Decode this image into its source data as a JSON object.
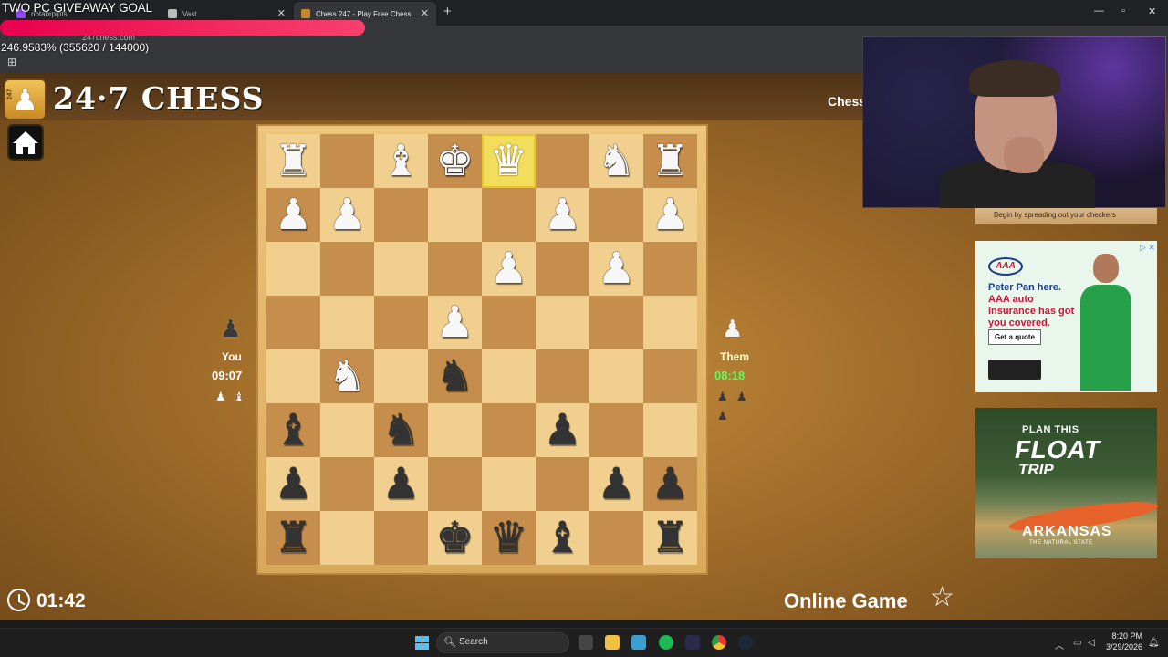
{
  "stream": {
    "giveaway_title": "TWO PC GIVEAWAY GOAL",
    "giveaway_progress": 2.469583,
    "giveaway_stats": "246.9583% (355620 / 144000)"
  },
  "browser": {
    "tabs": [
      {
        "label": "notabrpipts",
        "active": false
      },
      {
        "label": "Vast",
        "active": false
      },
      {
        "label": "Chess 247 - Play Free Chess",
        "active": true
      }
    ],
    "url": "247chess.com"
  },
  "header": {
    "logo_badge": "247",
    "logo_text": "24·7 CHESS",
    "nav_link": "Chess"
  },
  "board": {
    "highlight_square": "e8",
    "rows": [
      [
        "wR",
        "",
        "wB",
        "wK",
        "wQ",
        "",
        "wN",
        "wR"
      ],
      [
        "wP",
        "wP",
        "",
        "",
        "",
        "wP",
        "",
        "wP"
      ],
      [
        "",
        "",
        "",
        "",
        "wP",
        "",
        "wP",
        ""
      ],
      [
        "",
        "",
        "",
        "wP",
        "",
        "",
        "",
        ""
      ],
      [
        "",
        "wN",
        "",
        "bN",
        "",
        "",
        "",
        ""
      ],
      [
        "bB",
        "",
        "bN",
        "",
        "",
        "bP",
        "",
        ""
      ],
      [
        "bP",
        "",
        "bP",
        "",
        "",
        "",
        "bP",
        "bP"
      ],
      [
        "bR",
        "",
        "",
        "bK",
        "bQ",
        "bB",
        "",
        "bR"
      ]
    ]
  },
  "players": {
    "you": {
      "label": "You",
      "time": "09:07",
      "captured": [
        "wP",
        "wB"
      ]
    },
    "them": {
      "label": "Them",
      "time": "08:18",
      "captured": [
        "bP",
        "bP",
        "bP"
      ]
    }
  },
  "footer": {
    "game_clock": "01:42",
    "game_mode": "Online Game"
  },
  "ads": {
    "strip_text": "Begin by spreading out your checkers",
    "aaa": {
      "logo": "AAA",
      "line1": "Peter Pan here.",
      "line2": "AAA auto insurance has got you covered.",
      "cta": "Get a quote"
    },
    "arkansas": {
      "line1": "PLAN THIS",
      "line2": "FLOAT",
      "line3": "TRIP",
      "state": "ARKANSAS",
      "sub": "THE NATURAL STATE"
    }
  },
  "taskbar": {
    "search_label": "Search",
    "time": "8:20 PM",
    "date": "3/29/2026"
  },
  "colors": {
    "board_light": "#f0cf8f",
    "board_dark": "#c68e4c",
    "highlight": "#f2de5c",
    "them_time": "#5cff5c"
  }
}
